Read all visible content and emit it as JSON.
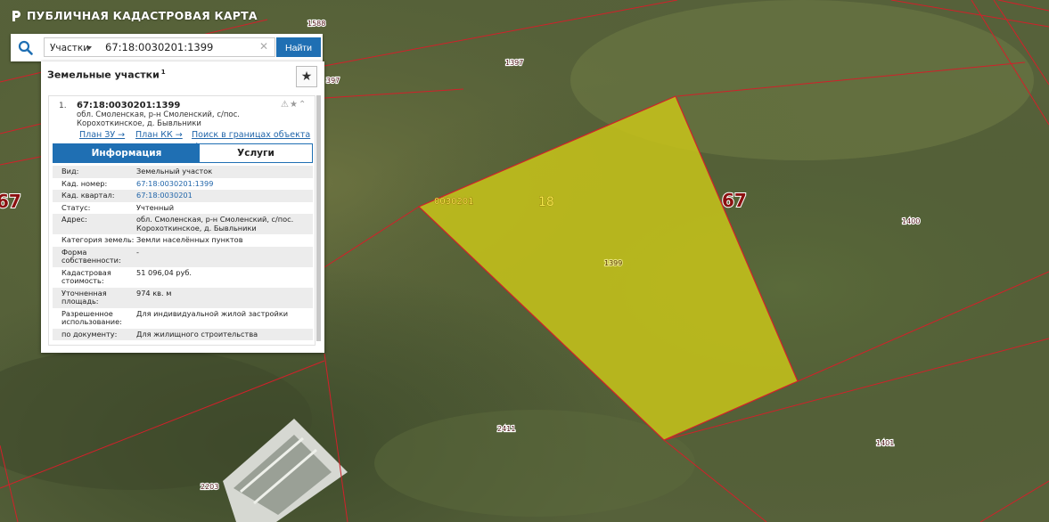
{
  "app": {
    "title": "ПУБЛИЧНАЯ КАДАСТРОВАЯ КАРТА"
  },
  "search": {
    "type_selected": "Участки",
    "query": "67:18:0030201:1399",
    "button_label": "Найти"
  },
  "panel": {
    "title": "Земельные участки",
    "count": "1",
    "card": {
      "index": "1.",
      "number": "67:18:0030201:1399",
      "address": "обл. Смоленская, р-н Смоленский, с/пос. Корохоткинское, д. Бывльники",
      "links": [
        "План ЗУ →",
        "План КК →",
        "Поиск в границах объекта →"
      ],
      "tabs": [
        "Информация",
        "Услуги"
      ],
      "attributes": [
        {
          "key": "Вид:",
          "value": "Земельный участок"
        },
        {
          "key": "Кад. номер:",
          "value": "67:18:0030201:1399",
          "link": true
        },
        {
          "key": "Кад. квартал:",
          "value": "67:18:0030201",
          "link": true
        },
        {
          "key": "Статус:",
          "value": "Учтенный"
        },
        {
          "key": "Адрес:",
          "value": "обл. Смоленская, р-н Смоленский, с/пос. Корохоткинское, д. Бывльники"
        },
        {
          "key": "Категория земель:",
          "value": "Земли населённых пунктов"
        },
        {
          "key": "Форма собственности:",
          "value": "-"
        },
        {
          "key": "Кадастровая стоимость:",
          "value": "51 096,04 руб."
        },
        {
          "key": "Уточненная площадь:",
          "value": "974 кв. м"
        },
        {
          "key": "Разрешенное использование:",
          "value": "Для индивидуальной жилой застройки"
        },
        {
          "key": "по документу:",
          "value": "Для жилищного строительства"
        }
      ]
    }
  },
  "map": {
    "parcel_labels": [
      "1588",
      "1397",
      "397",
      "1399",
      "1400",
      "2411",
      "1401",
      "2203"
    ],
    "quarter_label": "0030201",
    "district_label": "18",
    "region_labels": [
      "67",
      "67"
    ],
    "colors": {
      "parcel_fill": "#c8c41a",
      "boundary": "#d2202a"
    }
  }
}
